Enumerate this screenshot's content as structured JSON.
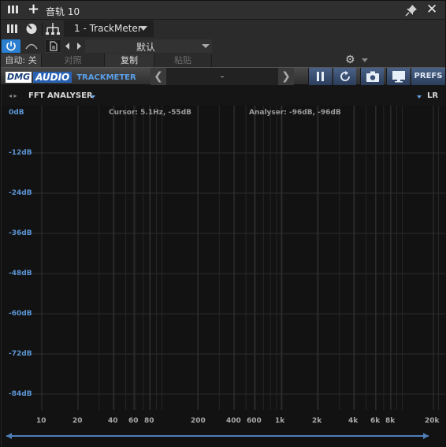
{
  "titlebar": {
    "title": "音轨 10"
  },
  "toolbar": {
    "preset_name": "1 - TrackMeter",
    "default_preset": "默认"
  },
  "row3": {
    "auto": "自动: 关",
    "compare": "对照",
    "copy": "复制",
    "paste": "粘贴"
  },
  "plugin": {
    "brand_dmg": "DMG",
    "brand_audio": "AUDIO",
    "product": "TRACKMETER",
    "preset_display": "-",
    "prefs_label": "PREFS"
  },
  "analyser": {
    "title": "FFT ANALYSER",
    "channel": "LR",
    "cursor_readout": "Cursor: 5.1Hz, -55dB",
    "analyser_readout": "Analyser: -96dB, -96dB",
    "db_labels": [
      "0dB",
      "-12dB",
      "-24dB",
      "-36dB",
      "-48dB",
      "-60dB",
      "-72dB",
      "-84dB"
    ],
    "freq_labels": [
      "10",
      "20",
      "40",
      "60",
      "80",
      "200",
      "400",
      "600",
      "1k",
      "2k",
      "4k",
      "6k",
      "8k",
      "20k"
    ]
  },
  "colors": {
    "accent": "#2a7fd0",
    "db_label": "#5c95d4",
    "plugin_button": "#3b5075"
  }
}
